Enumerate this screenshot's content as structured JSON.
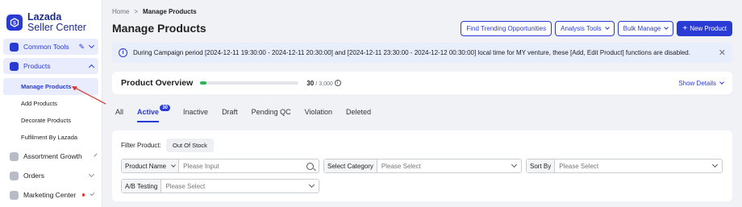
{
  "brand": {
    "line1": "Lazada",
    "line2": "Seller Center",
    "accent": "#2a3bd4"
  },
  "sidebar": {
    "common_tools": "Common Tools",
    "products": "Products",
    "product_items": [
      "Manage Products",
      "Add Products",
      "Decorate Products",
      "Fulfilment By Lazada"
    ],
    "assortment_growth": "Assortment Growth",
    "orders": "Orders",
    "marketing_center": "Marketing Center"
  },
  "breadcrumb": {
    "home": "Home",
    "sep": ">",
    "current": "Manage Products"
  },
  "page_title": "Manage Products",
  "actions": {
    "find_trending": "Find Trending Opportunities",
    "analysis_tools": "Analysis Tools",
    "bulk_manage": "Bulk Manage",
    "new_product": "New Product"
  },
  "notice": {
    "text": "During Campaign period [2024-12-11 19:30:00 - 2024-12-11 20:30:00] and [2024-12-11 23:30:00 - 2024-12-12 00:30:00] local time for MY venture, these [Add, Edit Product] functions are disabled."
  },
  "overview": {
    "title": "Product Overview",
    "count": "30",
    "total": "/ 3,000",
    "progress_fraction": 0.01,
    "show_details": "Show Details",
    "progress_color": "#2fb457"
  },
  "tabs": {
    "all": "All",
    "active": "Active",
    "active_count": "30",
    "inactive": "Inactive",
    "draft": "Draft",
    "pending_qc": "Pending QC",
    "violation": "Violation",
    "deleted": "Deleted"
  },
  "filters": {
    "filter_product_label": "Filter Product:",
    "out_of_stock": "Out Of Stock",
    "product_name_label": "Product Name",
    "product_name_placeholder": "Please Input",
    "select_category_label": "Select Category",
    "select_category_placeholder": "Please Select",
    "sort_by_label": "Sort By",
    "sort_by_placeholder": "Please Select",
    "ab_testing_label": "A/B Testing",
    "ab_testing_placeholder": "Please Select"
  }
}
